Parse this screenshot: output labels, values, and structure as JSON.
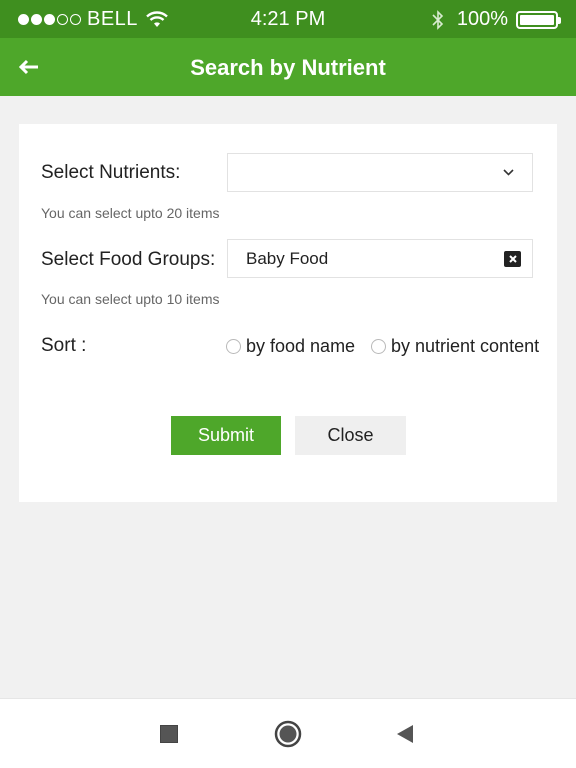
{
  "status_bar": {
    "carrier": "BELL",
    "time": "4:21 PM",
    "battery": "100%",
    "signal_dots_filled": 3,
    "signal_dots_total": 5
  },
  "header": {
    "title": "Search by Nutrient",
    "back_icon": "arrow-left-icon",
    "background": "#4ea72a"
  },
  "form": {
    "nutrients": {
      "label": "Select Nutrients:",
      "value": "",
      "hint": "You can select upto 20 items"
    },
    "food_groups": {
      "label": "Select Food Groups:",
      "value": "Baby Food",
      "hint": "You can select upto 10 items"
    },
    "sort": {
      "label": "Sort :",
      "options": [
        "by food name",
        "by nutrient content"
      ]
    },
    "submit_label": "Submit",
    "close_label": "Close"
  },
  "nav": {
    "icons": [
      "square-icon",
      "circle-icon",
      "triangle-back-icon"
    ]
  },
  "colors": {
    "status_bar": "#3f8f1f",
    "accent": "#4ea72a"
  }
}
